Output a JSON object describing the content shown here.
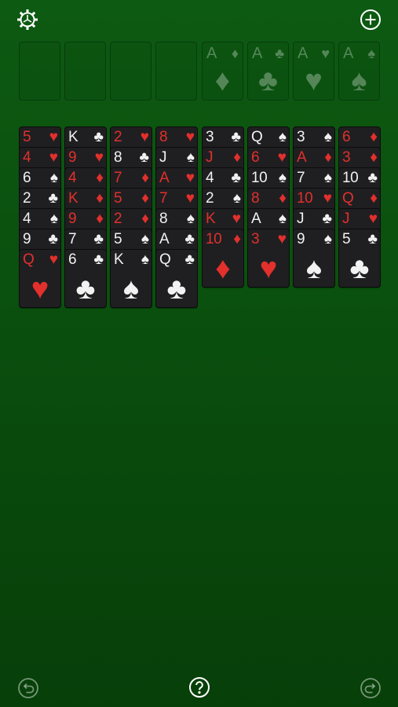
{
  "colors": {
    "red": "#e2302c",
    "black": "#f2f2f2",
    "felt": "#0b5510",
    "card_bg": "#1f1f21"
  },
  "toolbar": {
    "settings_icon": "gear-icon",
    "new_game_icon": "plus-circle-icon",
    "undo_icon": "undo-icon",
    "help_icon": "question-circle-icon",
    "redo_icon": "redo-icon"
  },
  "free_cells": [
    {},
    {},
    {},
    {}
  ],
  "foundations": [
    {
      "rank": "A",
      "suit": "♦"
    },
    {
      "rank": "A",
      "suit": "♣"
    },
    {
      "rank": "A",
      "suit": "♥"
    },
    {
      "rank": "A",
      "suit": "♠"
    }
  ],
  "tableau": [
    [
      {
        "rank": "5",
        "suit": "♥"
      },
      {
        "rank": "4",
        "suit": "♥"
      },
      {
        "rank": "6",
        "suit": "♠"
      },
      {
        "rank": "2",
        "suit": "♣"
      },
      {
        "rank": "4",
        "suit": "♠"
      },
      {
        "rank": "9",
        "suit": "♣"
      },
      {
        "rank": "Q",
        "suit": "♥"
      }
    ],
    [
      {
        "rank": "K",
        "suit": "♣"
      },
      {
        "rank": "9",
        "suit": "♥"
      },
      {
        "rank": "4",
        "suit": "♦"
      },
      {
        "rank": "K",
        "suit": "♦"
      },
      {
        "rank": "9",
        "suit": "♦"
      },
      {
        "rank": "7",
        "suit": "♣"
      },
      {
        "rank": "6",
        "suit": "♣"
      }
    ],
    [
      {
        "rank": "2",
        "suit": "♥"
      },
      {
        "rank": "8",
        "suit": "♣"
      },
      {
        "rank": "7",
        "suit": "♦"
      },
      {
        "rank": "5",
        "suit": "♦"
      },
      {
        "rank": "2",
        "suit": "♦"
      },
      {
        "rank": "5",
        "suit": "♠"
      },
      {
        "rank": "K",
        "suit": "♠"
      }
    ],
    [
      {
        "rank": "8",
        "suit": "♥"
      },
      {
        "rank": "J",
        "suit": "♠"
      },
      {
        "rank": "A",
        "suit": "♥"
      },
      {
        "rank": "7",
        "suit": "♥"
      },
      {
        "rank": "8",
        "suit": "♠"
      },
      {
        "rank": "A",
        "suit": "♣"
      },
      {
        "rank": "Q",
        "suit": "♣"
      }
    ],
    [
      {
        "rank": "3",
        "suit": "♣"
      },
      {
        "rank": "J",
        "suit": "♦"
      },
      {
        "rank": "4",
        "suit": "♣"
      },
      {
        "rank": "2",
        "suit": "♠"
      },
      {
        "rank": "K",
        "suit": "♥"
      },
      {
        "rank": "10",
        "suit": "♦"
      }
    ],
    [
      {
        "rank": "Q",
        "suit": "♠"
      },
      {
        "rank": "6",
        "suit": "♥"
      },
      {
        "rank": "10",
        "suit": "♠"
      },
      {
        "rank": "8",
        "suit": "♦"
      },
      {
        "rank": "A",
        "suit": "♠"
      },
      {
        "rank": "3",
        "suit": "♥"
      }
    ],
    [
      {
        "rank": "3",
        "suit": "♠"
      },
      {
        "rank": "A",
        "suit": "♦"
      },
      {
        "rank": "7",
        "suit": "♠"
      },
      {
        "rank": "10",
        "suit": "♥"
      },
      {
        "rank": "J",
        "suit": "♣"
      },
      {
        "rank": "9",
        "suit": "♠"
      }
    ],
    [
      {
        "rank": "6",
        "suit": "♦"
      },
      {
        "rank": "3",
        "suit": "♦"
      },
      {
        "rank": "10",
        "suit": "♣"
      },
      {
        "rank": "Q",
        "suit": "♦"
      },
      {
        "rank": "J",
        "suit": "♥"
      },
      {
        "rank": "5",
        "suit": "♣"
      }
    ]
  ]
}
